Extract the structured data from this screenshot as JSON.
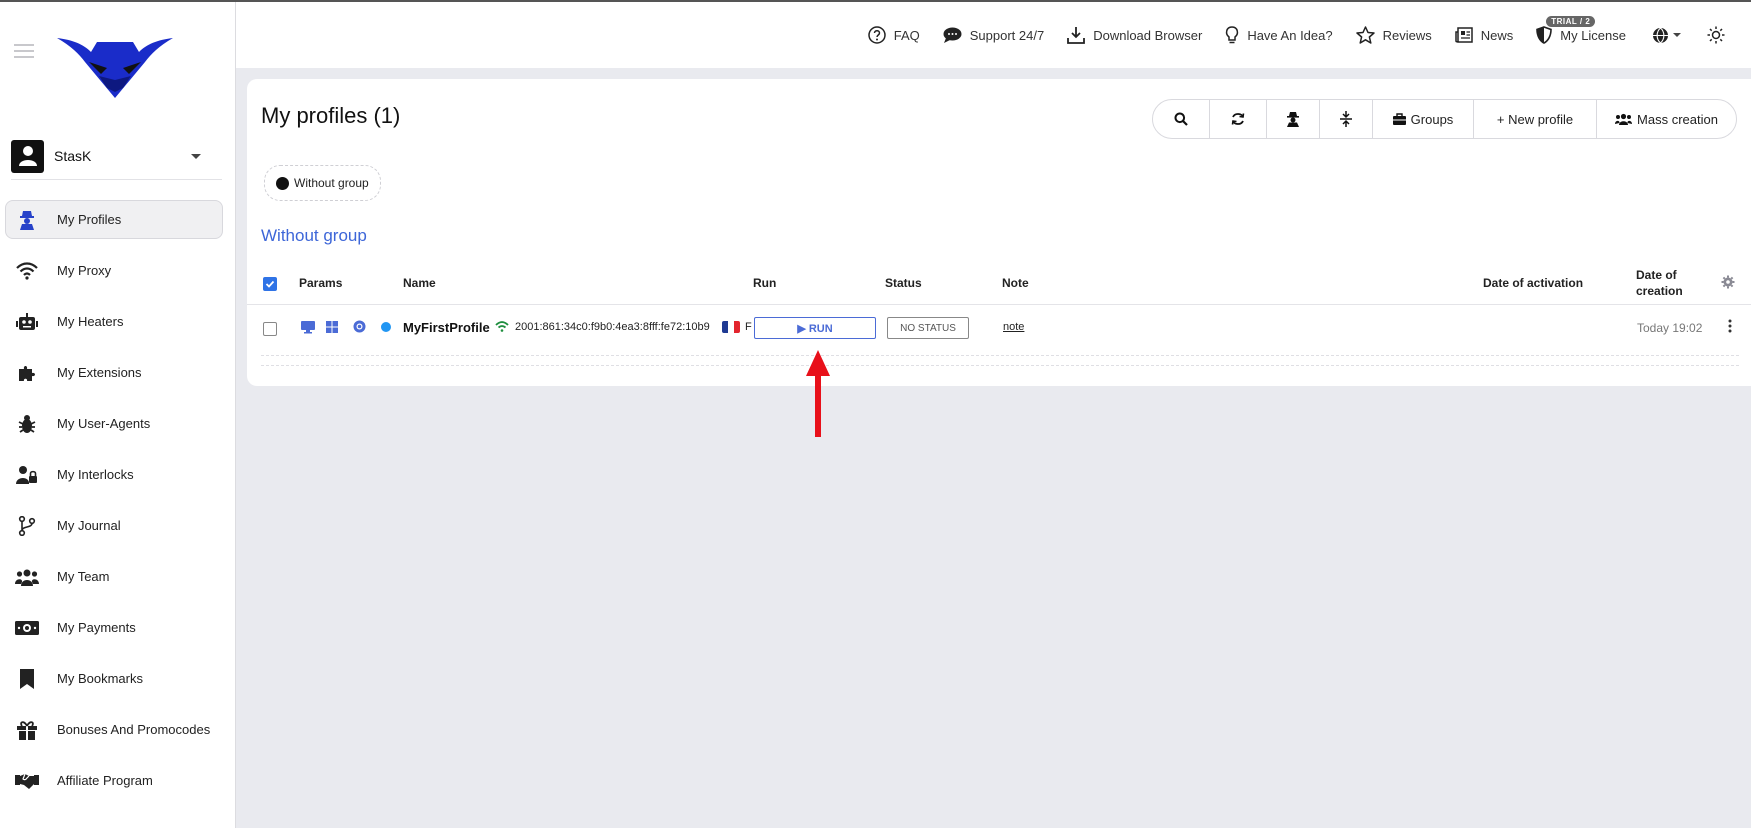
{
  "user": {
    "name": "StasK"
  },
  "sidebar": {
    "items": [
      {
        "label": "My Profiles",
        "icon": "profiles-icon"
      },
      {
        "label": "My Proxy",
        "icon": "wifi-icon"
      },
      {
        "label": "My Heaters",
        "icon": "robot-icon"
      },
      {
        "label": "My Extensions",
        "icon": "puzzle-icon"
      },
      {
        "label": "My User-Agents",
        "icon": "bug-icon"
      },
      {
        "label": "My Interlocks",
        "icon": "user-lock-icon"
      },
      {
        "label": "My Journal",
        "icon": "branch-icon"
      },
      {
        "label": "My Team",
        "icon": "team-icon"
      },
      {
        "label": "My Payments",
        "icon": "money-icon"
      },
      {
        "label": "My Bookmarks",
        "icon": "bookmark-icon"
      },
      {
        "label": "Bonuses And Promocodes",
        "icon": "gift-icon"
      },
      {
        "label": "Affiliate Program",
        "icon": "handshake-icon"
      }
    ]
  },
  "topnav": {
    "faq": "FAQ",
    "support": "Support 24/7",
    "download": "Download Browser",
    "idea": "Have An Idea?",
    "reviews": "Reviews",
    "news": "News",
    "license": "My License",
    "trial_badge": "TRIAL / 2"
  },
  "main": {
    "title": "My profiles (1)",
    "toolbar": {
      "groups": "Groups",
      "new_profile": "+ New profile",
      "mass_creation": "Mass creation"
    },
    "group_chip": "Without group",
    "group_title": "Without group",
    "columns": {
      "params": "Params",
      "name": "Name",
      "run": "Run",
      "status": "Status",
      "note": "Note",
      "date_activation": "Date of activation",
      "date_creation": "Date of creation"
    },
    "profile": {
      "name": "MyFirstProfile",
      "ip": "2001:861:34c0:f9b0:4ea3:8fff:fe72:10b9",
      "country_letter": "F",
      "run_label": "▶ RUN",
      "status_label": "NO STATUS",
      "note": "note",
      "created": "Today 19:02"
    }
  },
  "colors": {
    "accent": "#3d66d8",
    "arrow": "#e8101a",
    "status_dot": "#2196f3"
  }
}
